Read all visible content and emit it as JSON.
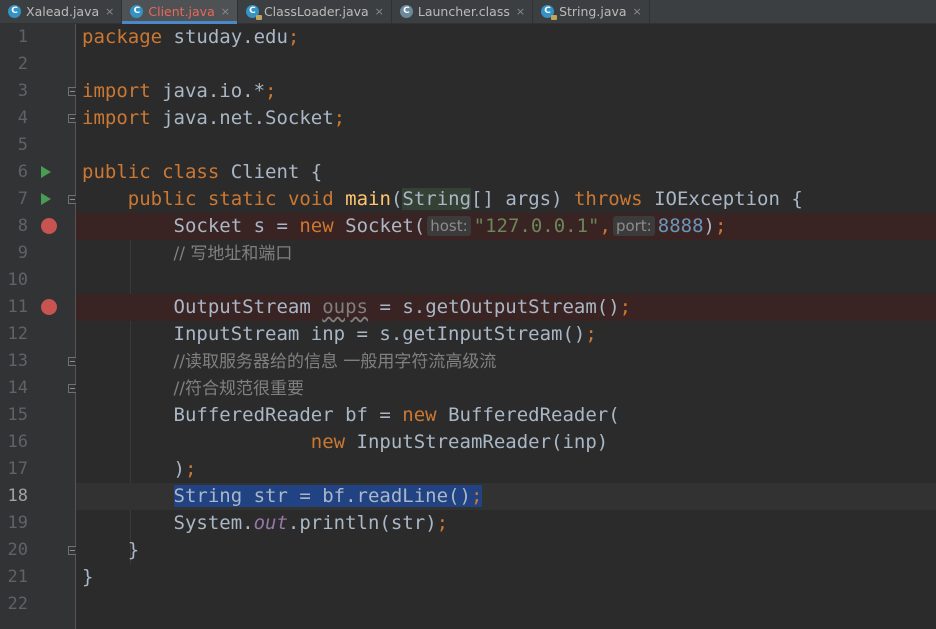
{
  "tabs": [
    {
      "label": "Xalead.java",
      "icon": "java-class-icon",
      "modified": true,
      "active": false
    },
    {
      "label": "Client.java",
      "icon": "java-class-icon",
      "modified": true,
      "active": true
    },
    {
      "label": "ClassLoader.java",
      "icon": "java-class-locked-icon",
      "modified": false,
      "active": false
    },
    {
      "label": "Launcher.class",
      "icon": "compiled-class-icon",
      "modified": false,
      "active": false
    },
    {
      "label": "String.java",
      "icon": "java-class-locked-icon",
      "modified": false,
      "active": false
    }
  ],
  "tab_close_glyph": "×",
  "line_numbers": [
    "1",
    "2",
    "3",
    "4",
    "5",
    "6",
    "7",
    "8",
    "9",
    "10",
    "11",
    "12",
    "13",
    "14",
    "15",
    "16",
    "17",
    "18",
    "19",
    "20",
    "21",
    "22"
  ],
  "current_line": 18,
  "breakpoint_lines": [
    8,
    11
  ],
  "run_marker_lines": [
    6,
    7
  ],
  "code": {
    "l1": {
      "kw": "package",
      "rest": " studay.edu",
      "semi": ";"
    },
    "l3": {
      "kw": "import",
      "rest": " java.io.*",
      "semi": ";"
    },
    "l4": {
      "kw": "import",
      "rest": " java.net.Socket",
      "semi": ";"
    },
    "l6": {
      "kw1": "public",
      "kw2": "class",
      "name": " Client {"
    },
    "l7": {
      "kw1": "public",
      "kw2": "static",
      "kw3": "void",
      "fn": "main",
      "p1": "(",
      "type": "String",
      "p2": "[] args) ",
      "kw4": "throws",
      "rest": " IOException {"
    },
    "l8": {
      "a": "Socket s = ",
      "kw": "new",
      "b": " Socket(",
      "hint1": "host:",
      "str": "\"127.0.0.1\"",
      "comma": ",",
      "hint2": "port:",
      "num": "8888",
      "c": ")",
      "semi": ";"
    },
    "l9": {
      "comment": "// 写地址和端口"
    },
    "l11": {
      "a": "OutputStream ",
      "unused": "oups",
      "b": " = s.getOutputStream()",
      "semi": ";"
    },
    "l12": {
      "a": "InputStream inp = s.getInputStream()",
      "semi": ";"
    },
    "l13": {
      "comment": "//读取服务器给的信息 一般用字符流高级流"
    },
    "l14": {
      "comment": "//符合规范很重要"
    },
    "l15": {
      "a": "BufferedReader bf = ",
      "kw": "new",
      "b": " BufferedReader("
    },
    "l16": {
      "kw": "new",
      "b": " InputStreamReader(inp)"
    },
    "l17": {
      "a": ")",
      "semi": ";"
    },
    "l18": {
      "a": "String str = bf.readLine()",
      "semi": ";"
    },
    "l19": {
      "a": "System.",
      "field": "out",
      "b": ".println(str)",
      "semi": ";"
    },
    "l20": {
      "a": "}"
    },
    "l21": {
      "a": "}"
    }
  },
  "colors": {
    "background": "#2b2b2b",
    "gutter": "#313335",
    "keyword": "#cc7832",
    "string": "#6a8759",
    "number": "#6897bb",
    "function": "#ffc66d",
    "comment": "#808080",
    "breakpoint": "#c75450",
    "selection": "#214283",
    "text": "#a9b7c6"
  }
}
